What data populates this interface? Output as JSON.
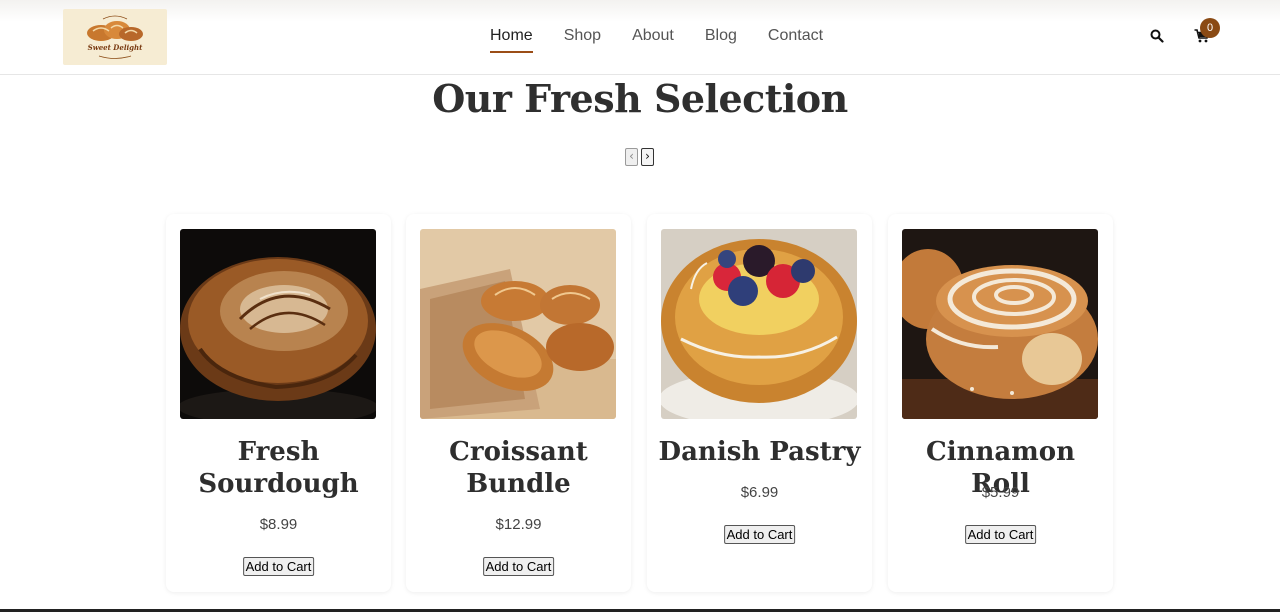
{
  "header": {
    "logo": {
      "text": "Sweet Delight"
    },
    "nav": [
      {
        "label": "Home",
        "active": true
      },
      {
        "label": "Shop",
        "active": false
      },
      {
        "label": "About",
        "active": false
      },
      {
        "label": "Blog",
        "active": false
      },
      {
        "label": "Contact",
        "active": false
      }
    ],
    "search_icon": "search-icon",
    "cart_icon": "cart-icon",
    "cart_count": "0"
  },
  "section": {
    "title": "Our Fresh Selection",
    "prev_icon": "chevron-left-icon",
    "next_icon": "chevron-right-icon"
  },
  "products": [
    {
      "name": "Fresh Sourdough",
      "price": "$8.99",
      "button": "Add to Cart"
    },
    {
      "name": "Croissant Bundle",
      "price": "$12.99",
      "button": "Add to Cart"
    },
    {
      "name": "Danish Pastry",
      "price": "$6.99",
      "button": "Add to Cart"
    },
    {
      "name": "Cinnamon Roll",
      "price": "$5.99",
      "button": "Add to Cart"
    }
  ],
  "colors": {
    "accent": "#9b4d17",
    "badge": "#8a4a14",
    "logo_bg": "#f6ecd3"
  }
}
